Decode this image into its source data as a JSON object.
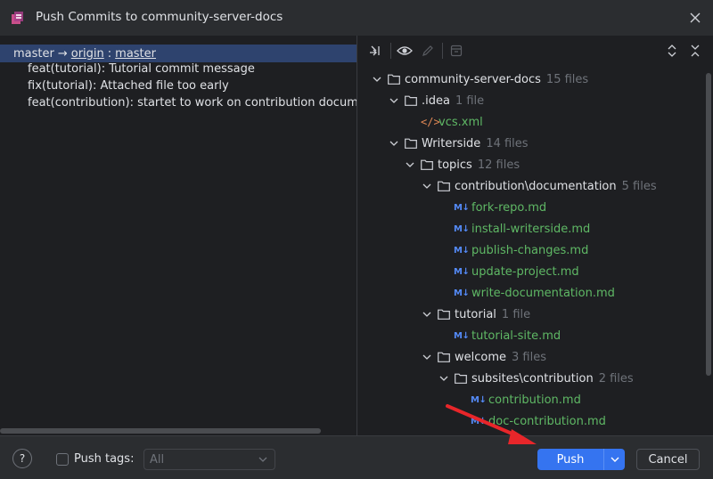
{
  "window": {
    "title": "Push Commits to community-server-docs"
  },
  "branch": {
    "local": "master",
    "arrow": "→",
    "remote": "origin",
    "separator": ":",
    "remote_branch": "master"
  },
  "commits": [
    "feat(tutorial): Tutorial commit message",
    "fix(tutorial): Attached file too early",
    "feat(contribution): startet to work on contribution documentation"
  ],
  "tree": {
    "root": {
      "name": "community-server-docs",
      "count": "15 files"
    },
    "idea": {
      "name": ".idea",
      "count": "1 file"
    },
    "vcs": {
      "name": "vcs.xml"
    },
    "writerside": {
      "name": "Writerside",
      "count": "14 files"
    },
    "topics": {
      "name": "topics",
      "count": "12 files"
    },
    "contribdoc": {
      "name": "contribution\\documentation",
      "count": "5 files"
    },
    "files_contrib": [
      "fork-repo.md",
      "install-writerside.md",
      "publish-changes.md",
      "update-project.md",
      "write-documentation.md"
    ],
    "tutorial": {
      "name": "tutorial",
      "count": "1 file"
    },
    "tutorial_file": "tutorial-site.md",
    "welcome": {
      "name": "welcome",
      "count": "3 files"
    },
    "subsites": {
      "name": "subsites\\contribution",
      "count": "2 files"
    },
    "files_subsites": [
      "contribution.md",
      "doc-contribution.md"
    ],
    "md_icon": "M↓"
  },
  "footer": {
    "help": "?",
    "push_tags_label": "Push tags:",
    "push_tags_value": "All",
    "push_label": "Push",
    "cancel_label": "Cancel"
  },
  "colors": {
    "accent": "#3574f0",
    "selection": "#2e436e",
    "file_added": "#5fb865",
    "annotation_arrow": "#e8262a"
  }
}
